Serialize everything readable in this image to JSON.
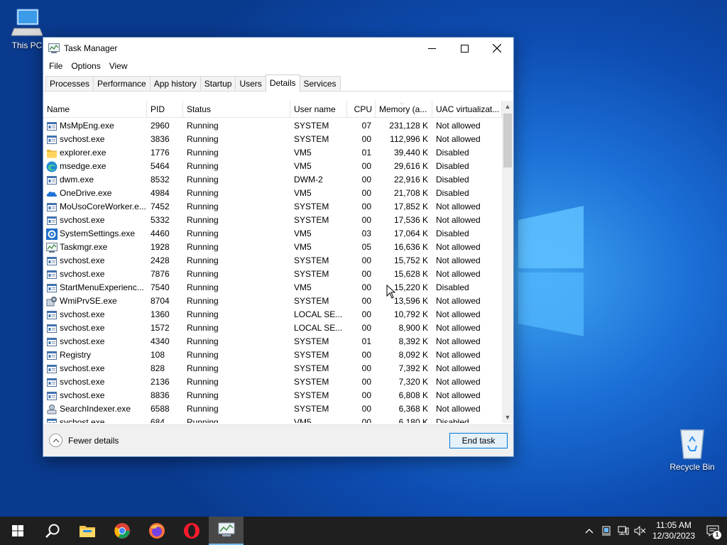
{
  "desktop": {
    "icons": {
      "this_pc": "This PC",
      "recycle_bin": "Recycle Bin"
    }
  },
  "window": {
    "title": "Task Manager",
    "menu": [
      "File",
      "Options",
      "View"
    ],
    "tabs": [
      "Processes",
      "Performance",
      "App history",
      "Startup",
      "Users",
      "Details",
      "Services"
    ],
    "active_tab": "Details",
    "columns": {
      "name": "Name",
      "pid": "PID",
      "status": "Status",
      "user": "User name",
      "cpu": "CPU",
      "memory": "Memory (a...",
      "uac": "UAC virtualizat..."
    },
    "rows": [
      {
        "icon": "service-icon",
        "name": "MsMpEng.exe",
        "pid": "2960",
        "status": "Running",
        "user": "SYSTEM",
        "cpu": "07",
        "mem": "231,128 K",
        "uac": "Not allowed"
      },
      {
        "icon": "service-icon",
        "name": "svchost.exe",
        "pid": "3836",
        "status": "Running",
        "user": "SYSTEM",
        "cpu": "00",
        "mem": "112,996 K",
        "uac": "Not allowed"
      },
      {
        "icon": "explorer-icon",
        "name": "explorer.exe",
        "pid": "1776",
        "status": "Running",
        "user": "VM5",
        "cpu": "01",
        "mem": "39,440 K",
        "uac": "Disabled"
      },
      {
        "icon": "edge-icon",
        "name": "msedge.exe",
        "pid": "5464",
        "status": "Running",
        "user": "VM5",
        "cpu": "00",
        "mem": "29,616 K",
        "uac": "Disabled"
      },
      {
        "icon": "service-icon",
        "name": "dwm.exe",
        "pid": "8532",
        "status": "Running",
        "user": "DWM-2",
        "cpu": "00",
        "mem": "22,916 K",
        "uac": "Disabled"
      },
      {
        "icon": "onedrive-icon",
        "name": "OneDrive.exe",
        "pid": "4984",
        "status": "Running",
        "user": "VM5",
        "cpu": "00",
        "mem": "21,708 K",
        "uac": "Disabled"
      },
      {
        "icon": "service-icon",
        "name": "MoUsoCoreWorker.e...",
        "pid": "7452",
        "status": "Running",
        "user": "SYSTEM",
        "cpu": "00",
        "mem": "17,852 K",
        "uac": "Not allowed"
      },
      {
        "icon": "service-icon",
        "name": "svchost.exe",
        "pid": "5332",
        "status": "Running",
        "user": "SYSTEM",
        "cpu": "00",
        "mem": "17,536 K",
        "uac": "Not allowed"
      },
      {
        "icon": "settings-icon",
        "name": "SystemSettings.exe",
        "pid": "4460",
        "status": "Running",
        "user": "VM5",
        "cpu": "03",
        "mem": "17,064 K",
        "uac": "Disabled"
      },
      {
        "icon": "taskmgr-icon",
        "name": "Taskmgr.exe",
        "pid": "1928",
        "status": "Running",
        "user": "VM5",
        "cpu": "05",
        "mem": "16,636 K",
        "uac": "Not allowed"
      },
      {
        "icon": "service-icon",
        "name": "svchost.exe",
        "pid": "2428",
        "status": "Running",
        "user": "SYSTEM",
        "cpu": "00",
        "mem": "15,752 K",
        "uac": "Not allowed"
      },
      {
        "icon": "service-icon",
        "name": "svchost.exe",
        "pid": "7876",
        "status": "Running",
        "user": "SYSTEM",
        "cpu": "00",
        "mem": "15,628 K",
        "uac": "Not allowed"
      },
      {
        "icon": "service-icon",
        "name": "StartMenuExperienc...",
        "pid": "7540",
        "status": "Running",
        "user": "VM5",
        "cpu": "00",
        "mem": "15,220 K",
        "uac": "Disabled"
      },
      {
        "icon": "wmi-icon",
        "name": "WmiPrvSE.exe",
        "pid": "8704",
        "status": "Running",
        "user": "SYSTEM",
        "cpu": "00",
        "mem": "13,596 K",
        "uac": "Not allowed"
      },
      {
        "icon": "service-icon",
        "name": "svchost.exe",
        "pid": "1360",
        "status": "Running",
        "user": "LOCAL SE...",
        "cpu": "00",
        "mem": "10,792 K",
        "uac": "Not allowed"
      },
      {
        "icon": "service-icon",
        "name": "svchost.exe",
        "pid": "1572",
        "status": "Running",
        "user": "LOCAL SE...",
        "cpu": "00",
        "mem": "8,900 K",
        "uac": "Not allowed"
      },
      {
        "icon": "service-icon",
        "name": "svchost.exe",
        "pid": "4340",
        "status": "Running",
        "user": "SYSTEM",
        "cpu": "01",
        "mem": "8,392 K",
        "uac": "Not allowed"
      },
      {
        "icon": "service-icon",
        "name": "Registry",
        "pid": "108",
        "status": "Running",
        "user": "SYSTEM",
        "cpu": "00",
        "mem": "8,092 K",
        "uac": "Not allowed"
      },
      {
        "icon": "service-icon",
        "name": "svchost.exe",
        "pid": "828",
        "status": "Running",
        "user": "SYSTEM",
        "cpu": "00",
        "mem": "7,392 K",
        "uac": "Not allowed"
      },
      {
        "icon": "service-icon",
        "name": "svchost.exe",
        "pid": "2136",
        "status": "Running",
        "user": "SYSTEM",
        "cpu": "00",
        "mem": "7,320 K",
        "uac": "Not allowed"
      },
      {
        "icon": "service-icon",
        "name": "svchost.exe",
        "pid": "8836",
        "status": "Running",
        "user": "SYSTEM",
        "cpu": "00",
        "mem": "6,808 K",
        "uac": "Not allowed"
      },
      {
        "icon": "search-indexer-icon",
        "name": "SearchIndexer.exe",
        "pid": "6588",
        "status": "Running",
        "user": "SYSTEM",
        "cpu": "00",
        "mem": "6,368 K",
        "uac": "Not allowed"
      },
      {
        "icon": "service-icon",
        "name": "svchost.exe",
        "pid": "684",
        "status": "Running",
        "user": "VM5",
        "cpu": "00",
        "mem": "6,180 K",
        "uac": "Disabled"
      }
    ],
    "footer": {
      "fewer_details": "Fewer details",
      "end_task": "End task"
    }
  },
  "taskbar": {
    "pinned": [
      "start-icon",
      "search-icon",
      "file-explorer-icon",
      "chrome-icon",
      "firefox-icon",
      "opera-icon",
      "taskmgr-icon"
    ],
    "clock_time": "11:05 AM",
    "clock_date": "12/30/2023",
    "notification_count": "1"
  }
}
